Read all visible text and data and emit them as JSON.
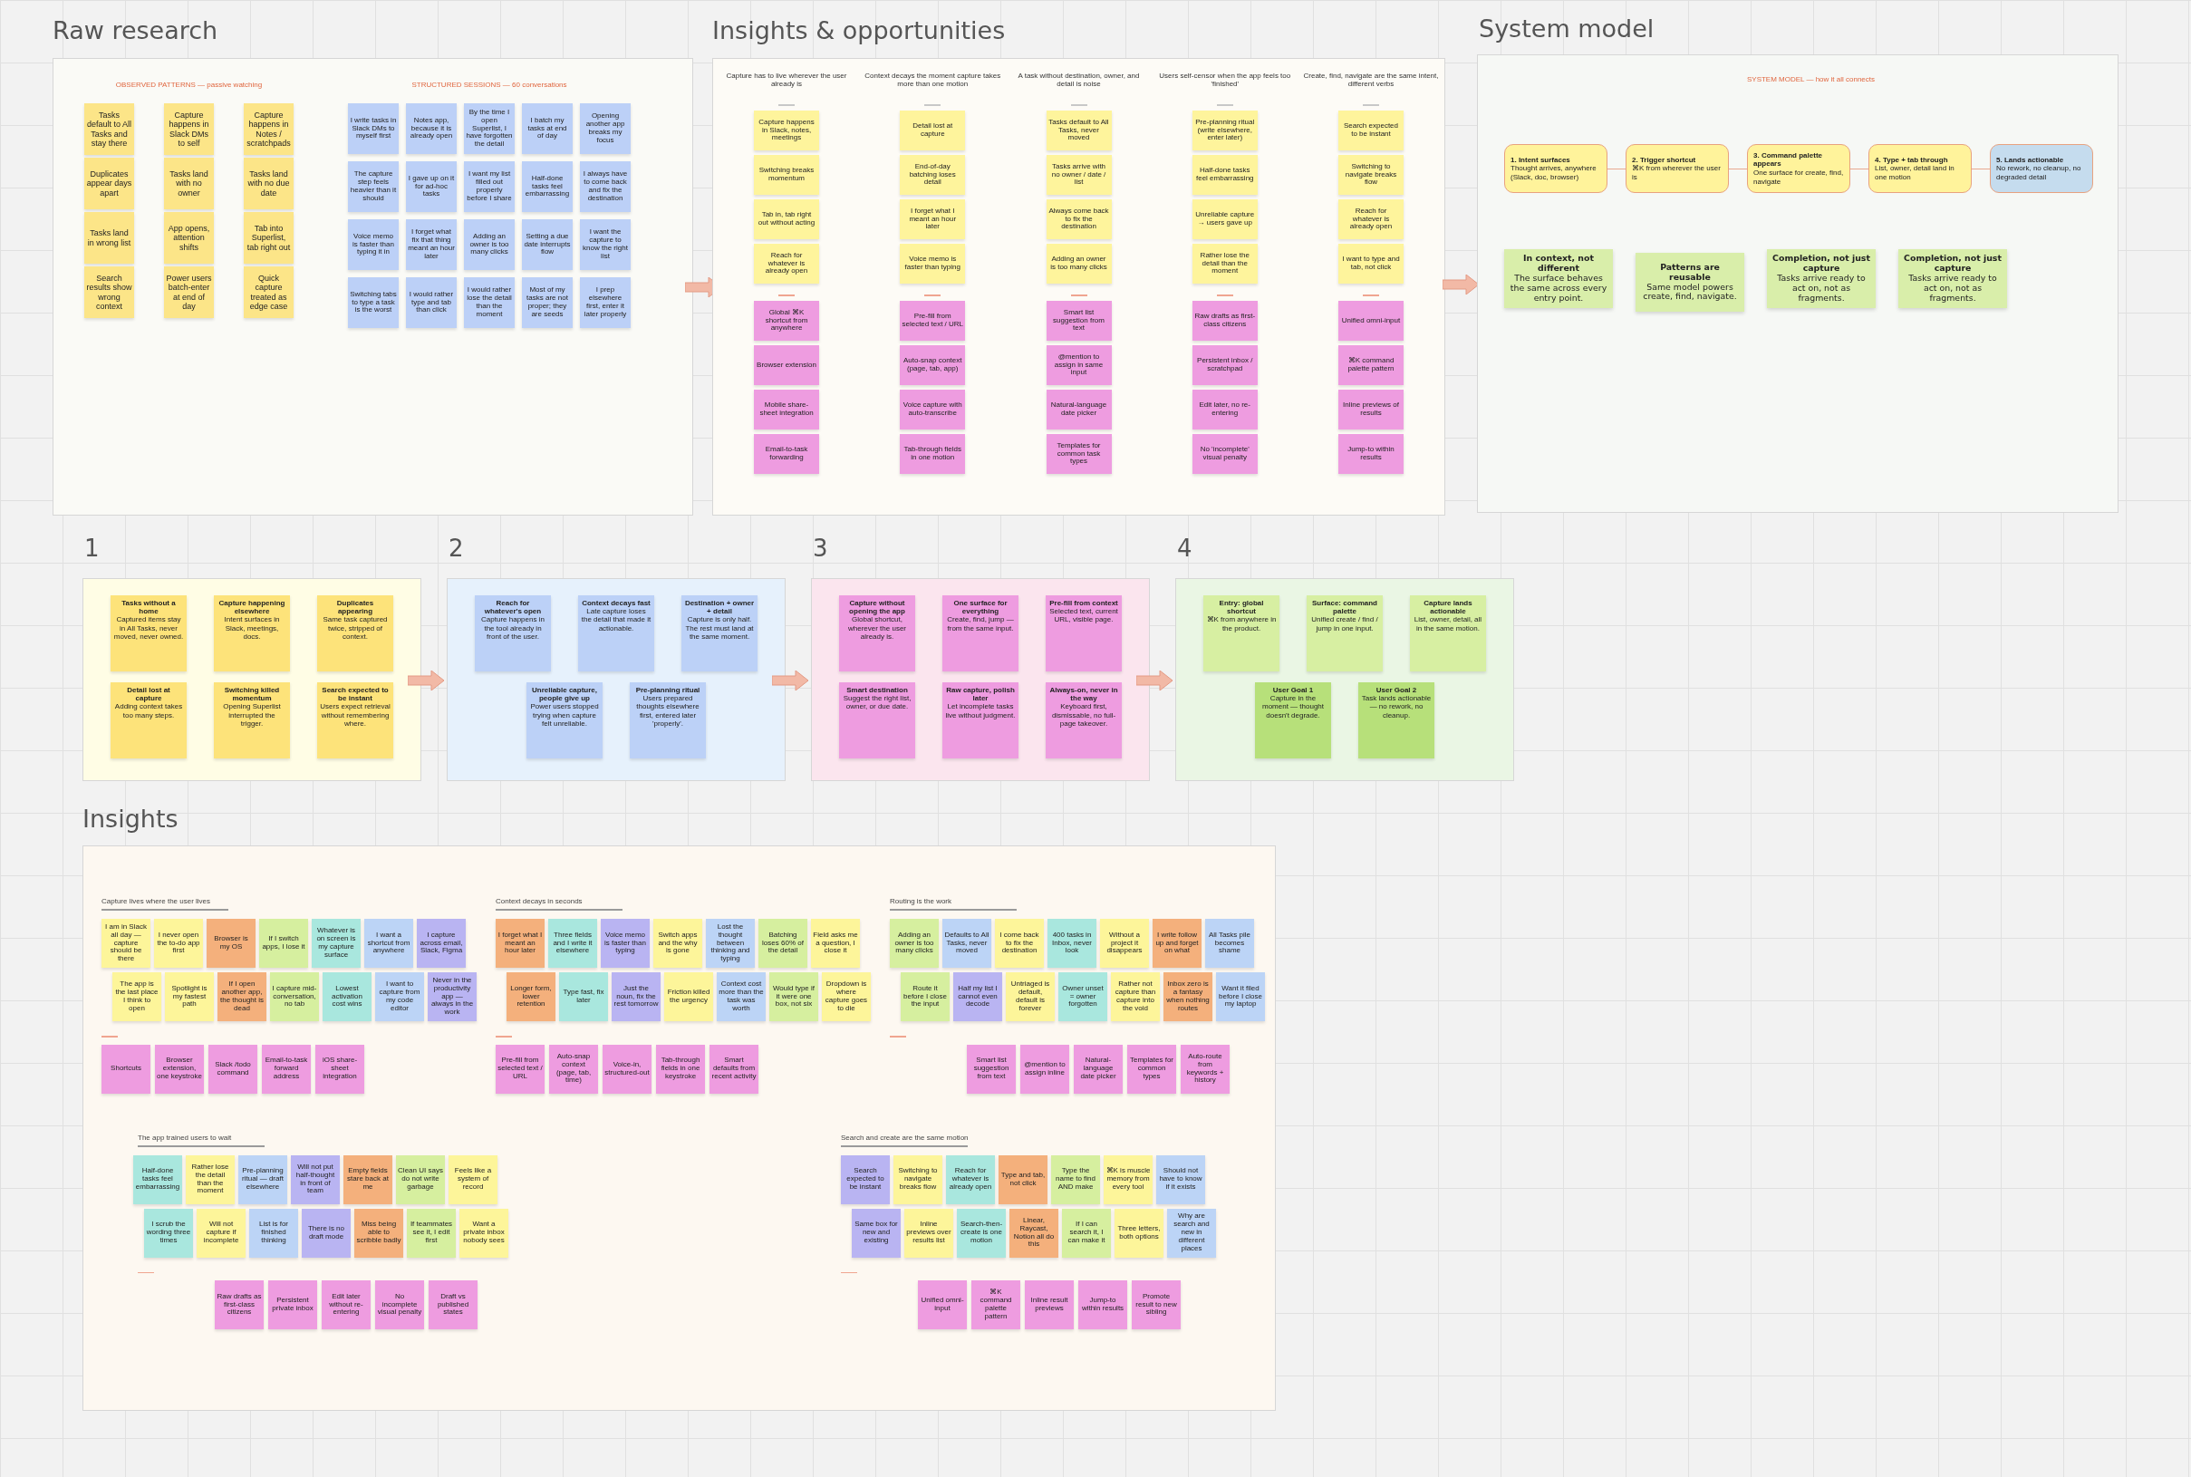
{
  "raw": {
    "title": "Raw research",
    "groups": [
      {
        "heading": "OBSERVED PATTERNS — passive watching",
        "rows": [
          [
            {
              "text": "Tasks default to All Tasks and stay there",
              "color": "#fce588"
            },
            {
              "text": "Capture happens in Slack DMs to self",
              "color": "#fce588"
            },
            {
              "text": "Capture happens in Notes / scratchpads",
              "color": "#fce588"
            }
          ],
          [
            {
              "text": "Duplicates appear days apart",
              "color": "#fce588"
            },
            {
              "text": "Tasks land with no owner",
              "color": "#fce588"
            },
            {
              "text": "Tasks land with no due date",
              "color": "#fce588"
            }
          ],
          [
            {
              "text": "Tasks land in wrong list",
              "color": "#fce588"
            },
            {
              "text": "App opens, attention shifts",
              "color": "#fce588"
            },
            {
              "text": "Tab into Superlist, tab right out",
              "color": "#fce588"
            }
          ],
          [
            {
              "text": "Search results show wrong context",
              "color": "#fce588"
            },
            {
              "text": "Power users batch-enter at end of day",
              "color": "#fce588"
            },
            {
              "text": "Quick capture treated as edge case",
              "color": "#fce588"
            }
          ]
        ]
      },
      {
        "heading": "STRUCTURED SESSIONS — 60 conversations",
        "rows": [
          [
            {
              "text": "I write tasks in Slack DMs to myself first",
              "color": "#bcd0f7"
            },
            {
              "text": "Notes app, because it is already open",
              "color": "#bcd0f7"
            },
            {
              "text": "By the time I open Superlist, I have forgotten the detail",
              "color": "#bcd0f7"
            },
            {
              "text": "I batch my tasks at end of day",
              "color": "#bcd0f7"
            },
            {
              "text": "Opening another app breaks my focus",
              "color": "#bcd0f7"
            }
          ],
          [
            {
              "text": "The capture step feels heavier than it should",
              "color": "#bcd0f7"
            },
            {
              "text": "I gave up on it for ad-hoc tasks",
              "color": "#bcd0f7"
            },
            {
              "text": "I want my list filled out properly before I share",
              "color": "#bcd0f7"
            },
            {
              "text": "Half-done tasks feel embarrassing",
              "color": "#bcd0f7"
            },
            {
              "text": "I always have to come back and fix the destination",
              "color": "#bcd0f7"
            }
          ],
          [
            {
              "text": "Voice memo is faster than typing it in",
              "color": "#bcd0f7"
            },
            {
              "text": "I forget what fix that thing meant an hour later",
              "color": "#bcd0f7"
            },
            {
              "text": "Adding an owner is too many clicks",
              "color": "#bcd0f7"
            },
            {
              "text": "Setting a due date interrupts flow",
              "color": "#bcd0f7"
            },
            {
              "text": "I want the capture to know the right list",
              "color": "#bcd0f7"
            }
          ],
          [
            {
              "text": "Switching tabs to type a task is the worst",
              "color": "#bcd0f7"
            },
            {
              "text": "I would rather type and tab than click",
              "color": "#bcd0f7"
            },
            {
              "text": "I would rather lose the detail than the moment",
              "color": "#bcd0f7"
            },
            {
              "text": "Most of my tasks are not proper; they are seeds",
              "color": "#bcd0f7"
            },
            {
              "text": "I prep elsewhere first, enter it later properly",
              "color": "#bcd0f7"
            }
          ]
        ]
      }
    ]
  },
  "opportunities": {
    "title": "Insights & opportunities",
    "columns": [
      {
        "heading": "Capture has to live wherever the user already is",
        "problems": [
          {
            "text": "Capture happens in Slack, notes, meetings",
            "color": "#fef49c"
          },
          {
            "text": "Switching breaks momentum",
            "color": "#fef49c"
          },
          {
            "text": "Tab in, tab right out without acting",
            "color": "#fef49c"
          },
          {
            "text": "Reach for whatever is already open",
            "color": "#fef49c"
          }
        ],
        "ideas": [
          {
            "text": "Global ⌘K shortcut from anywhere",
            "color": "#ee9ce0"
          },
          {
            "text": "Browser extension",
            "color": "#ee9ce0"
          },
          {
            "text": "Mobile share-sheet integration",
            "color": "#ee9ce0"
          },
          {
            "text": "Email-to-task forwarding",
            "color": "#ee9ce0"
          }
        ]
      },
      {
        "heading": "Context decays the moment capture takes more than one motion",
        "problems": [
          {
            "text": "Detail lost at capture",
            "color": "#fef49c"
          },
          {
            "text": "End-of-day batching loses detail",
            "color": "#fef49c"
          },
          {
            "text": "I forget what I meant an hour later",
            "color": "#fef49c"
          },
          {
            "text": "Voice memo is faster than typing",
            "color": "#fef49c"
          }
        ],
        "ideas": [
          {
            "text": "Pre-fill from selected text / URL",
            "color": "#ee9ce0"
          },
          {
            "text": "Auto-snap context (page, tab, app)",
            "color": "#ee9ce0"
          },
          {
            "text": "Voice capture with auto-transcribe",
            "color": "#ee9ce0"
          },
          {
            "text": "Tab-through fields in one motion",
            "color": "#ee9ce0"
          }
        ]
      },
      {
        "heading": "A task without destination, owner, and detail is noise",
        "problems": [
          {
            "text": "Tasks default to All Tasks, never moved",
            "color": "#fef49c"
          },
          {
            "text": "Tasks arrive with no owner / date / list",
            "color": "#fef49c"
          },
          {
            "text": "Always come back to fix the destination",
            "color": "#fef49c"
          },
          {
            "text": "Adding an owner is too many clicks",
            "color": "#fef49c"
          }
        ],
        "ideas": [
          {
            "text": "Smart list suggestion from text",
            "color": "#ee9ce0"
          },
          {
            "text": "@mention to assign in same input",
            "color": "#ee9ce0"
          },
          {
            "text": "Natural-language date picker",
            "color": "#ee9ce0"
          },
          {
            "text": "Templates for common task types",
            "color": "#ee9ce0"
          }
        ]
      },
      {
        "heading": "Users self-censor when the app feels too 'finished'",
        "problems": [
          {
            "text": "Pre-planning ritual (write elsewhere, enter later)",
            "color": "#fef49c"
          },
          {
            "text": "Half-done tasks feel embarrassing",
            "color": "#fef49c"
          },
          {
            "text": "Unreliable capture → users gave up",
            "color": "#fef49c"
          },
          {
            "text": "Rather lose the detail than the moment",
            "color": "#fef49c"
          }
        ],
        "ideas": [
          {
            "text": "Raw drafts as first-class citizens",
            "color": "#ee9ce0"
          },
          {
            "text": "Persistent inbox / scratchpad",
            "color": "#ee9ce0"
          },
          {
            "text": "Edit later, no re-entering",
            "color": "#ee9ce0"
          },
          {
            "text": "No 'incomplete' visual penalty",
            "color": "#ee9ce0"
          }
        ]
      },
      {
        "heading": "Create, find, navigate are the same intent, different verbs",
        "problems": [
          {
            "text": "Search expected to be instant",
            "color": "#fef49c"
          },
          {
            "text": "Switching to navigate breaks flow",
            "color": "#fef49c"
          },
          {
            "text": "Reach for whatever is already open",
            "color": "#fef49c"
          },
          {
            "text": "I want to type and tab, not click",
            "color": "#fef49c"
          }
        ],
        "ideas": [
          {
            "text": "Unified omni-input",
            "color": "#ee9ce0"
          },
          {
            "text": "⌘K command palette pattern",
            "color": "#ee9ce0"
          },
          {
            "text": "Inline previews of results",
            "color": "#ee9ce0"
          },
          {
            "text": "Jump-to within results",
            "color": "#ee9ce0"
          }
        ]
      }
    ]
  },
  "system": {
    "title": "System model",
    "heading": "SYSTEM MODEL — how it all connects",
    "flow": [
      {
        "title": "1. Intent surfaces",
        "text": "Thought arrives, anywhere (Slack, doc, browser)",
        "color": "#fff39b"
      },
      {
        "title": "2. Trigger shortcut",
        "text": "⌘K from wherever the user is",
        "color": "#fff39b"
      },
      {
        "title": "3. Command palette appears",
        "text": "One surface for create, find, navigate",
        "color": "#fff39b"
      },
      {
        "title": "4. Type + tab through",
        "text": "List, owner, detail land in one motion",
        "color": "#fff39b"
      },
      {
        "title": "5. Lands actionable",
        "text": "No rework, no cleanup, no degraded detail",
        "color": "#c5dcee"
      }
    ],
    "principles": [
      {
        "title": "In context, not different",
        "text": "The surface behaves the same across every entry point."
      },
      {
        "title": "Patterns are reusable",
        "text": "Same model powers create, find, navigate."
      },
      {
        "title": "Completion, not just capture",
        "text": "Tasks arrive ready to act on, not as fragments."
      },
      {
        "title": "Completion, not just capture",
        "text": "Tasks arrive ready to act on, not as fragments."
      }
    ]
  },
  "steps": [
    {
      "number": "1",
      "color": "#fffde5",
      "rows": [
        [
          {
            "title": "Tasks without a home",
            "text": "Captured items stay in All Tasks, never moved, never owned.",
            "color": "#fde37a"
          },
          {
            "title": "Capture happening elsewhere",
            "text": "Intent surfaces in Slack, meetings, docs.",
            "color": "#fde37a"
          },
          {
            "title": "Duplicates appearing",
            "text": "Same task captured twice, stripped of context.",
            "color": "#fde37a"
          }
        ],
        [
          {
            "title": "Detail lost at capture",
            "text": "Adding context takes too many steps.",
            "color": "#fde37a"
          },
          {
            "title": "Switching killed momentum",
            "text": "Opening Superlist interrupted the trigger.",
            "color": "#fde37a"
          },
          {
            "title": "Search expected to be instant",
            "text": "Users expect retrieval without remembering where.",
            "color": "#fde37a"
          }
        ]
      ]
    },
    {
      "number": "2",
      "color": "#e6f1fc",
      "rows": [
        [
          {
            "title": "Reach for whatever's open",
            "text": "Capture happens in the tool already in front of the user.",
            "color": "#bcd1f7"
          },
          {
            "title": "Context decays fast",
            "text": "Late capture loses the detail that made it actionable.",
            "color": "#bcd1f7"
          },
          {
            "title": "Destination + owner + detail",
            "text": "Capture is only half. The rest must land at the same moment.",
            "color": "#bcd1f7"
          }
        ],
        [
          {
            "title": "Unreliable capture, people give up",
            "text": "Power users stopped trying when capture felt unreliable.",
            "color": "#bcd1f7"
          },
          {
            "title": "Pre-planning ritual",
            "text": "Users prepared thoughts elsewhere first, entered later 'properly'.",
            "color": "#bcd1f7"
          }
        ]
      ]
    },
    {
      "number": "3",
      "color": "#fbe5ee",
      "rows": [
        [
          {
            "title": "Capture without opening the app",
            "text": "Global shortcut, wherever the user already is.",
            "color": "#ee9ce0"
          },
          {
            "title": "One surface for everything",
            "text": "Create, find, jump — from the same input.",
            "color": "#ee9ce0"
          },
          {
            "title": "Pre-fill from context",
            "text": "Selected text, current URL, visible page.",
            "color": "#ee9ce0"
          }
        ],
        [
          {
            "title": "Smart destination",
            "text": "Suggest the right list, owner, or due date.",
            "color": "#ee9ce0"
          },
          {
            "title": "Raw capture, polish later",
            "text": "Let incomplete tasks live without judgment.",
            "color": "#ee9ce0"
          },
          {
            "title": "Always-on, never in the way",
            "text": "Keyboard first, dismissable, no full-page takeover.",
            "color": "#ee9ce0"
          }
        ]
      ]
    },
    {
      "number": "4",
      "color": "#eaf6e4",
      "rows": [
        [
          {
            "title": "Entry: global shortcut",
            "text": "⌘K from anywhere in the product.",
            "color": "#d7efa2"
          },
          {
            "title": "Surface: command palette",
            "text": "Unified create / find / jump in one input.",
            "color": "#d7efa2"
          },
          {
            "title": "Capture lands actionable",
            "text": "List, owner, detail, all in the same motion.",
            "color": "#d7efa2"
          }
        ],
        [
          {
            "title": "User Goal 1",
            "text": "Capture in the moment — thought doesn't degrade.",
            "color": "#b7e07a"
          },
          {
            "title": "User Goal 2",
            "text": "Task lands actionable — no rework, no cleanup.",
            "color": "#b7e07a"
          }
        ]
      ]
    }
  ],
  "insights": {
    "title": "Insights",
    "clusters": [
      {
        "heading": "Capture lives where the user lives",
        "rows": [
          [
            {
              "text": "I am in Slack all day — capture should be there",
              "color": "#fdf59a"
            },
            {
              "text": "I never open the to-do app first",
              "color": "#fdf59a"
            },
            {
              "text": "Browser is my OS",
              "color": "#f4b07c"
            },
            {
              "text": "If I switch apps, I lose it",
              "color": "#d6ef9f"
            },
            {
              "text": "Whatever is on screen is my capture surface",
              "color": "#a9e7de"
            },
            {
              "text": "I want a shortcut from anywhere",
              "color": "#bcd4f6"
            },
            {
              "text": "I capture across email, Slack, Figma",
              "color": "#b9b4f2"
            }
          ],
          [
            {
              "text": "The app is the last place I think to open",
              "color": "#fdf59a"
            },
            {
              "text": "Spotlight is my fastest path",
              "color": "#fdf59a"
            },
            {
              "text": "If I open another app, the thought is dead",
              "color": "#f4b07c"
            },
            {
              "text": "I capture mid-conversation, no tab",
              "color": "#d6ef9f"
            },
            {
              "text": "Lowest activation cost wins",
              "color": "#a9e7de"
            },
            {
              "text": "I want to capture from my code editor",
              "color": "#bcd4f6"
            },
            {
              "text": "Never in the productivity app — always in the work",
              "color": "#b9b4f2"
            }
          ]
        ],
        "ideas": [
          {
            "text": "Shortcuts",
            "color": "#ee9ce0"
          },
          {
            "text": "Browser extension, one keystroke",
            "color": "#ee9ce0"
          },
          {
            "text": "Slack /todo command",
            "color": "#ee9ce0"
          },
          {
            "text": "Email-to-task forward address",
            "color": "#ee9ce0"
          },
          {
            "text": "iOS share-sheet integration",
            "color": "#ee9ce0"
          }
        ]
      },
      {
        "heading": "Context decays in seconds",
        "rows": [
          [
            {
              "text": "I forget what I meant an hour later",
              "color": "#f4b07c"
            },
            {
              "text": "Three fields and I write it elsewhere",
              "color": "#a9e7de"
            },
            {
              "text": "Voice memo is faster than typing",
              "color": "#b9b4f2"
            },
            {
              "text": "Switch apps and the why is gone",
              "color": "#fdf59a"
            },
            {
              "text": "Lost the thought between thinking and typing",
              "color": "#bcd4f6"
            },
            {
              "text": "Batching loses 60% of the detail",
              "color": "#d6ef9f"
            },
            {
              "text": "Field asks me a question, I close it",
              "color": "#fdf59a"
            }
          ],
          [
            {
              "text": "Longer form, lower retention",
              "color": "#f4b07c"
            },
            {
              "text": "Type fast, fix later",
              "color": "#a9e7de"
            },
            {
              "text": "Just the noun, fix the rest tomorrow",
              "color": "#b9b4f2"
            },
            {
              "text": "Friction killed the urgency",
              "color": "#fdf59a"
            },
            {
              "text": "Context cost more than the task was worth",
              "color": "#bcd4f6"
            },
            {
              "text": "Would type if it were one box, not six",
              "color": "#d6ef9f"
            },
            {
              "text": "Dropdown is where capture goes to die",
              "color": "#fdf59a"
            }
          ]
        ],
        "ideas": [
          {
            "text": "Pre-fill from selected text / URL",
            "color": "#ee9ce0"
          },
          {
            "text": "Auto-snap context (page, tab, time)",
            "color": "#ee9ce0"
          },
          {
            "text": "Voice-in, structured-out",
            "color": "#ee9ce0"
          },
          {
            "text": "Tab-through fields in one keystroke",
            "color": "#ee9ce0"
          },
          {
            "text": "Smart defaults from recent activity",
            "color": "#ee9ce0"
          }
        ]
      },
      {
        "heading": "Routing is the work",
        "rows": [
          [
            {
              "text": "Adding an owner is too many clicks",
              "color": "#d6ef9f"
            },
            {
              "text": "Defaults to All Tasks, never moved",
              "color": "#bcd4f6"
            },
            {
              "text": "I come back to fix the destination",
              "color": "#fdf59a"
            },
            {
              "text": "400 tasks in Inbox, never look",
              "color": "#a9e7de"
            },
            {
              "text": "Without a project it disappears",
              "color": "#fdf59a"
            },
            {
              "text": "I write follow up and forget on what",
              "color": "#f4b07c"
            },
            {
              "text": "All Tasks pile becomes shame",
              "color": "#bcd4f6"
            }
          ],
          [
            {
              "text": "Route it before I close the input",
              "color": "#d6ef9f"
            },
            {
              "text": "Half my list I cannot even decode",
              "color": "#b9b4f2"
            },
            {
              "text": "Untriaged is default, default is forever",
              "color": "#fdf59a"
            },
            {
              "text": "Owner unset = owner forgotten",
              "color": "#a9e7de"
            },
            {
              "text": "Rather not capture than capture into the void",
              "color": "#fdf59a"
            },
            {
              "text": "Inbox zero is a fantasy when nothing routes",
              "color": "#f4b07c"
            },
            {
              "text": "Want it filed before I close my laptop",
              "color": "#bcd4f6"
            }
          ]
        ],
        "ideas": [
          {
            "text": "Smart list suggestion from text",
            "color": "#ee9ce0"
          },
          {
            "text": "@mention to assign inline",
            "color": "#ee9ce0"
          },
          {
            "text": "Natural-language date picker",
            "color": "#ee9ce0"
          },
          {
            "text": "Templates for common types",
            "color": "#ee9ce0"
          },
          {
            "text": "Auto-route from keywords + history",
            "color": "#ee9ce0"
          }
        ]
      },
      {
        "heading": "The app trained users to wait",
        "rows": [
          [
            {
              "text": "Half-done tasks feel embarrassing",
              "color": "#a9e7de"
            },
            {
              "text": "Rather lose the detail than the moment",
              "color": "#fdf59a"
            },
            {
              "text": "Pre-planning ritual — draft elsewhere",
              "color": "#bcd4f6"
            },
            {
              "text": "Will not put half-thought in front of team",
              "color": "#b9b4f2"
            },
            {
              "text": "Empty fields stare back at me",
              "color": "#f4b07c"
            },
            {
              "text": "Clean UI says do not write garbage",
              "color": "#d6ef9f"
            },
            {
              "text": "Feels like a system of record",
              "color": "#fdf59a"
            }
          ],
          [
            {
              "text": "I scrub the wording three times",
              "color": "#a9e7de"
            },
            {
              "text": "Will not capture if incomplete",
              "color": "#fdf59a"
            },
            {
              "text": "List is for finished thinking",
              "color": "#bcd4f6"
            },
            {
              "text": "There is no draft mode",
              "color": "#b9b4f2"
            },
            {
              "text": "Miss being able to scribble badly",
              "color": "#f4b07c"
            },
            {
              "text": "If teammates see it, I edit first",
              "color": "#d6ef9f"
            },
            {
              "text": "Want a private inbox nobody sees",
              "color": "#fdf59a"
            }
          ]
        ],
        "ideas": [
          {
            "text": "Raw drafts as first-class citizens",
            "color": "#ee9ce0"
          },
          {
            "text": "Persistent private inbox",
            "color": "#ee9ce0"
          },
          {
            "text": "Edit later without re-entering",
            "color": "#ee9ce0"
          },
          {
            "text": "No incomplete visual penalty",
            "color": "#ee9ce0"
          },
          {
            "text": "Draft vs published states",
            "color": "#ee9ce0"
          }
        ]
      },
      {
        "heading": "Search and create are the same motion",
        "rows": [
          [
            {
              "text": "Search expected to be instant",
              "color": "#b9b4f2"
            },
            {
              "text": "Switching to navigate breaks flow",
              "color": "#fdf59a"
            },
            {
              "text": "Reach for whatever is already open",
              "color": "#a9e7de"
            },
            {
              "text": "Type and tab, not click",
              "color": "#f4b07c"
            },
            {
              "text": "Type the name to find AND make",
              "color": "#d6ef9f"
            },
            {
              "text": "⌘K is muscle memory from every tool",
              "color": "#fdf59a"
            },
            {
              "text": "Should not have to know if it exists",
              "color": "#bcd4f6"
            }
          ],
          [
            {
              "text": "Same box for new and existing",
              "color": "#b9b4f2"
            },
            {
              "text": "Inline previews over results list",
              "color": "#fdf59a"
            },
            {
              "text": "Search-then-create is one motion",
              "color": "#a9e7de"
            },
            {
              "text": "Linear, Raycast, Notion all do this",
              "color": "#f4b07c"
            },
            {
              "text": "If I can search it, I can make it",
              "color": "#d6ef9f"
            },
            {
              "text": "Three letters, both options",
              "color": "#fdf59a"
            },
            {
              "text": "Why are search and new in different places",
              "color": "#bcd4f6"
            }
          ]
        ],
        "ideas": [
          {
            "text": "Unified omni-input",
            "color": "#ee9ce0"
          },
          {
            "text": "⌘K command palette pattern",
            "color": "#ee9ce0"
          },
          {
            "text": "Inline result previews",
            "color": "#ee9ce0"
          },
          {
            "text": "Jump-to within results",
            "color": "#ee9ce0"
          },
          {
            "text": "Promote result to new sibling",
            "color": "#ee9ce0"
          }
        ]
      }
    ]
  }
}
